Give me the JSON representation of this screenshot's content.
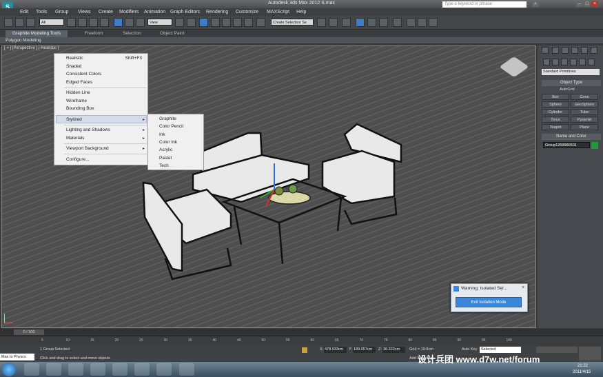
{
  "window": {
    "title": "Autodesk 3ds Max  2012      S.max",
    "search_placeholder": "Type a keyword or phrase"
  },
  "menu": [
    "Edit",
    "Tools",
    "Group",
    "Views",
    "Create",
    "Modifiers",
    "Animation",
    "Graph Editors",
    "Rendering",
    "Customize",
    "MAXScript",
    "Help"
  ],
  "toolbar": {
    "selection_filter": "All",
    "ref_coord": "View",
    "named_set": "Create Selection Se"
  },
  "ribbon": {
    "tabs": [
      "Graphite Modeling Tools",
      "Freeform",
      "Selection",
      "Object Paint"
    ],
    "panel": "Polygon Modeling"
  },
  "viewport": {
    "label": "[ + ] [Perspective ] [ Realistic ]"
  },
  "context_menu": {
    "items": [
      {
        "label": "Realistic",
        "shortcut": "Shift+F3"
      },
      {
        "label": "Shaded"
      },
      {
        "label": "Consistent Colors"
      },
      {
        "label": "Edged Faces"
      },
      {
        "label": "Hidden Line"
      },
      {
        "label": "Wireframe"
      },
      {
        "label": "Bounding Box"
      },
      {
        "label": "Stylized"
      },
      {
        "label": "Lighting and Shadows"
      },
      {
        "label": "Materials"
      },
      {
        "label": "Viewport Background"
      },
      {
        "label": "Configure..."
      }
    ],
    "submenu": [
      "Graphite",
      "Color Pencil",
      "Ink",
      "Color Ink",
      "Acrylic",
      "Pastel",
      "Tech"
    ]
  },
  "command_panel": {
    "category": "Standard Primitives",
    "object_type": "Object Type",
    "autogrid": "AutoGrid",
    "buttons": [
      "Box",
      "Cone",
      "Sphere",
      "GeoSphere",
      "Cylinder",
      "Tube",
      "Torus",
      "Pyramid",
      "Teapot",
      "Plane"
    ],
    "name_and_color": "Name and Color",
    "name_value": "Group1269980501",
    "color": "#1f9a3a"
  },
  "isolation_dialog": {
    "title": "Warning: Isolated Sel...",
    "button": "Exit Isolation Mode"
  },
  "timeline": {
    "frame": "0 / 100",
    "ticks": [
      "5",
      "10",
      "15",
      "20",
      "25",
      "30",
      "35",
      "40",
      "45",
      "50",
      "55",
      "60",
      "65",
      "70",
      "75",
      "80",
      "85",
      "90",
      "95",
      "100"
    ]
  },
  "status": {
    "script_listener": "Max to Physcs",
    "selection": "1 Group Selected",
    "prompt": "Click and drag to select and move objects",
    "x": "478.933cm",
    "y": "189.057cm",
    "z": "38.322cm",
    "grid": "Grid = 10.0cm",
    "autokey": "Auto Key",
    "setkey_mode": "Selected",
    "add_time_tag": "Add Time Tag"
  },
  "taskbar": {
    "time": "21:22",
    "date": "2011/4/15"
  },
  "watermark": "设计兵团 www.d7w.net/forum"
}
